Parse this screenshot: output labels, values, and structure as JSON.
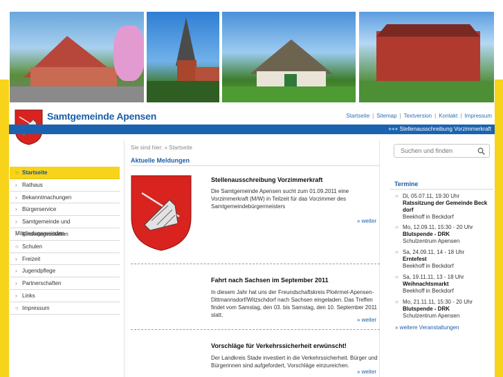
{
  "site": {
    "name": "Samtgemeinde Apensen"
  },
  "topnav": [
    "Startseite",
    "Sitemap",
    "Textversion",
    "Kontakt",
    "Impressum"
  ],
  "ticker": "+++  Stellenausschreibung Vorzimmerkraft",
  "breadcrumb": "Sie sind hier: » Startseite",
  "section_title": "Aktuelle Meldungen",
  "leftnav": [
    {
      "label": "Startseite",
      "marker": "○"
    },
    {
      "label": "Rathaus",
      "marker": "›"
    },
    {
      "label": "Bekanntmachungen",
      "marker": "›"
    },
    {
      "label": "Bürgerservice",
      "marker": "›"
    },
    {
      "label": "Samtgemeinde und Mitgliedsgemeinden",
      "marker": "›"
    },
    {
      "label": "Kindertagesstätten",
      "marker": "›"
    },
    {
      "label": "Schulen",
      "marker": "○"
    },
    {
      "label": "Freizeit",
      "marker": "›"
    },
    {
      "label": "Jugendpflege",
      "marker": "›"
    },
    {
      "label": "Partnerschaften",
      "marker": "›"
    },
    {
      "label": "Links",
      "marker": "›"
    },
    {
      "label": "Impressum",
      "marker": "○"
    }
  ],
  "news": [
    {
      "title": "Stellenausschreibung Vorzimmerkraft",
      "text": "Die Samtgemeinde Apensen sucht zum 01.09.2011 eine Vorzimmerkraft (M/W) in Teilzeit für das Vorzimmer des Samtgemeindebürgermeisters",
      "more": "» weiter"
    },
    {
      "title": "Fahrt nach Sachsen im September 2011",
      "text": "In diesem Jahr hat uns der Freundschaftskreis Ploërmel-Apensen-Dittmannsdorf/Witzschdorf nach Sachsen eingeladen. Das Treffen findet vom Samstag, den 03. bis Samstag, den 10. September 2011 statt.",
      "more": "» weiter"
    },
    {
      "title": "Vorschläge für Verkehrssicherheit erwünscht!",
      "text": "Der Landkreis Stade investiert in die Verkehrssicherheit. Bürger und Bürgerinnen sind aufgefordert, Vorschläge einzureichen.",
      "more": "» weiter"
    }
  ],
  "search": {
    "placeholder": "Suchen und finden"
  },
  "events": {
    "title": "Termine",
    "items": [
      {
        "date": "Di, 05.07.11, 19:30 Uhr",
        "name": "Ratssitzung der Gemeinde Beck dorf",
        "place": "Beekhoff in Beckdorf"
      },
      {
        "date": "Mo, 12.09.11, 15:30 - 20 Uhr",
        "name": "Blutspende - DRK",
        "place": "Schulzentrum Apensen"
      },
      {
        "date": "Sa, 24.09.11, 14 - 18 Uhr",
        "name": "Erntefest",
        "place": "Beekhoff in Beckdorf"
      },
      {
        "date": "Sa, 19.11.11, 13 - 18 Uhr",
        "name": "Weihnachtsmarkt",
        "place": "Beekhoff in Beckdorf"
      },
      {
        "date": "Mo, 21.11.11, 15:30 - 20 Uhr",
        "name": "Blutspende - DRK",
        "place": "Schulzentrum Apensen"
      }
    ],
    "more": "» weitere Veranstaltungen"
  },
  "colors": {
    "accent_yellow": "#f7d31a",
    "brand_blue": "#1b63b0",
    "crest_red": "#d8231f"
  },
  "icons": {
    "search": "magnifier-icon",
    "crest": "coat-of-arms-icon"
  }
}
